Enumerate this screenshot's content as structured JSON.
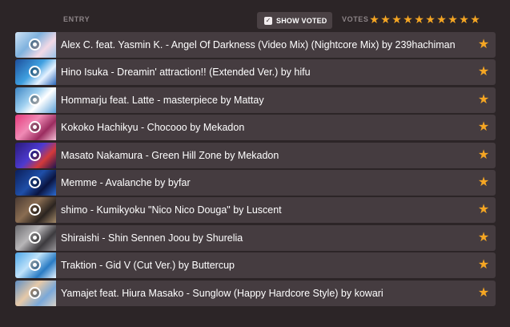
{
  "header": {
    "entry_label": "ENTRY",
    "show_voted_label": "SHOW VOTED",
    "show_voted_checked": true,
    "votes_label": "VOTES",
    "vote_filter_star_count": 10
  },
  "colors": {
    "background": "#2c2527",
    "row_background": "#453c40",
    "accent_star": "#f5a623",
    "header_text": "#8c8487"
  },
  "entries": [
    {
      "title": "Alex C. feat. Yasmin K. - Angel Of Darkness (Video Mix) (Nightcore Mix) by 239hachiman",
      "voted": true,
      "thumb_icon": "play-icon"
    },
    {
      "title": "Hino Isuka - Dreamin' attraction!! (Extended Ver.) by hifu",
      "voted": true,
      "thumb_icon": "play-icon"
    },
    {
      "title": "Hommarju feat. Latte - masterpiece by Mattay",
      "voted": true,
      "thumb_icon": "play-icon"
    },
    {
      "title": "Kokoko Hachikyu - Chocooo by Mekadon",
      "voted": true,
      "thumb_icon": "play-icon"
    },
    {
      "title": "Masato Nakamura - Green Hill Zone by Mekadon",
      "voted": true,
      "thumb_icon": "play-icon"
    },
    {
      "title": "Memme - Avalanche by byfar",
      "voted": true,
      "thumb_icon": "play-icon"
    },
    {
      "title": "shimo - Kumikyoku \"Nico Nico Douga\" by Luscent",
      "voted": true,
      "thumb_icon": "play-icon"
    },
    {
      "title": "Shiraishi - Shin Sennen Joou by Shurelia",
      "voted": true,
      "thumb_icon": "play-icon"
    },
    {
      "title": "Traktion - Gid V (Cut Ver.) by Buttercup",
      "voted": true,
      "thumb_icon": "play-icon"
    },
    {
      "title": "Yamajet feat. Hiura Masako - Sunglow (Happy Hardcore Style) by kowari",
      "voted": true,
      "thumb_icon": "play-icon"
    }
  ]
}
